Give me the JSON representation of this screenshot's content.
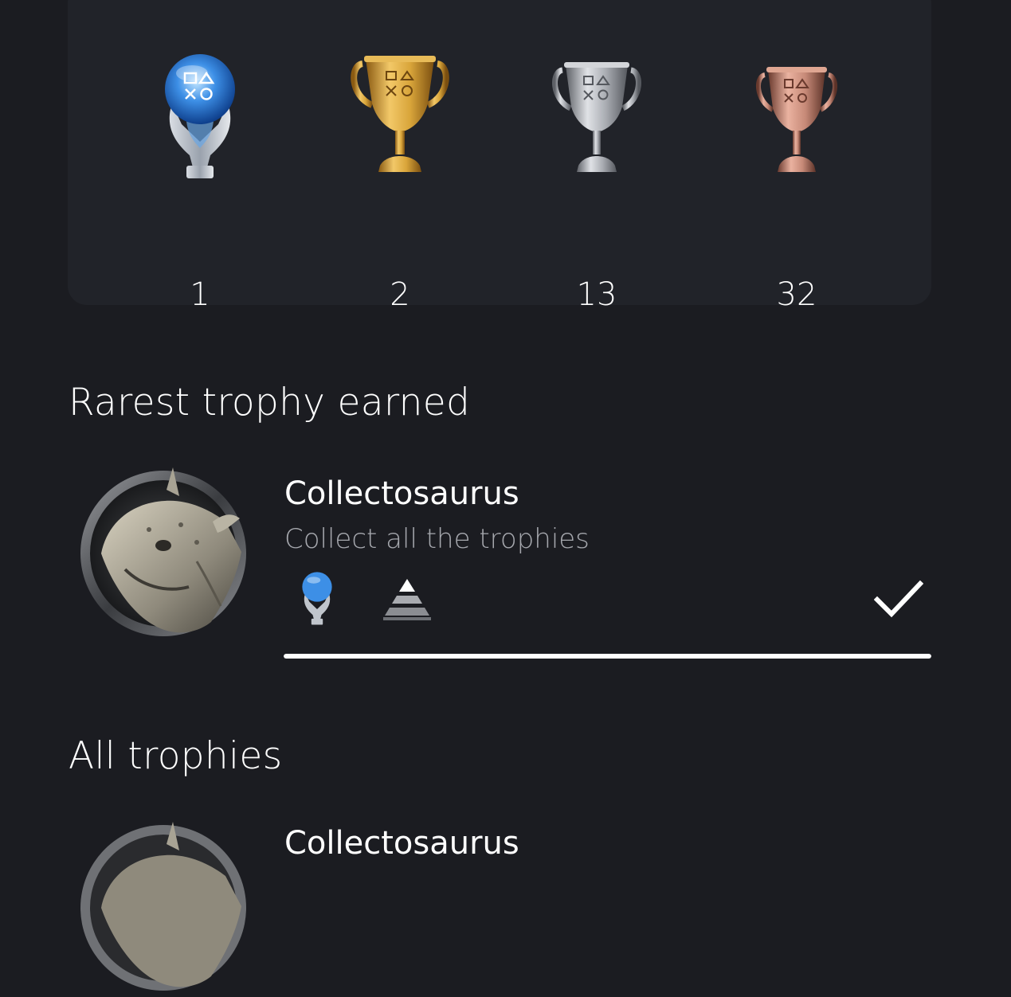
{
  "summary": {
    "platinum_count": "1",
    "gold_count": "2",
    "silver_count": "13",
    "bronze_count": "32",
    "icons": [
      "platinum-trophy-icon",
      "gold-trophy-icon",
      "silver-trophy-icon",
      "bronze-trophy-icon"
    ]
  },
  "rarest": {
    "heading": "Rarest trophy earned",
    "name": "Collectosaurus",
    "description": "Collect all the trophies",
    "grade_icon": "platinum-trophy-icon",
    "rarity_icon": "rarity-pyramid-icon",
    "status_icon": "check-icon",
    "progress": 1.0
  },
  "all_trophies": {
    "heading": "All trophies",
    "items": [
      {
        "name": "Collectosaurus"
      }
    ]
  },
  "colors": {
    "background": "#1b1c21",
    "card": "#212329",
    "secondary_text": "#a6a8ae",
    "platinum": "#5aa8ff",
    "gold": "#d9a53a",
    "silver": "#b8b9bd",
    "bronze": "#c78a78"
  }
}
